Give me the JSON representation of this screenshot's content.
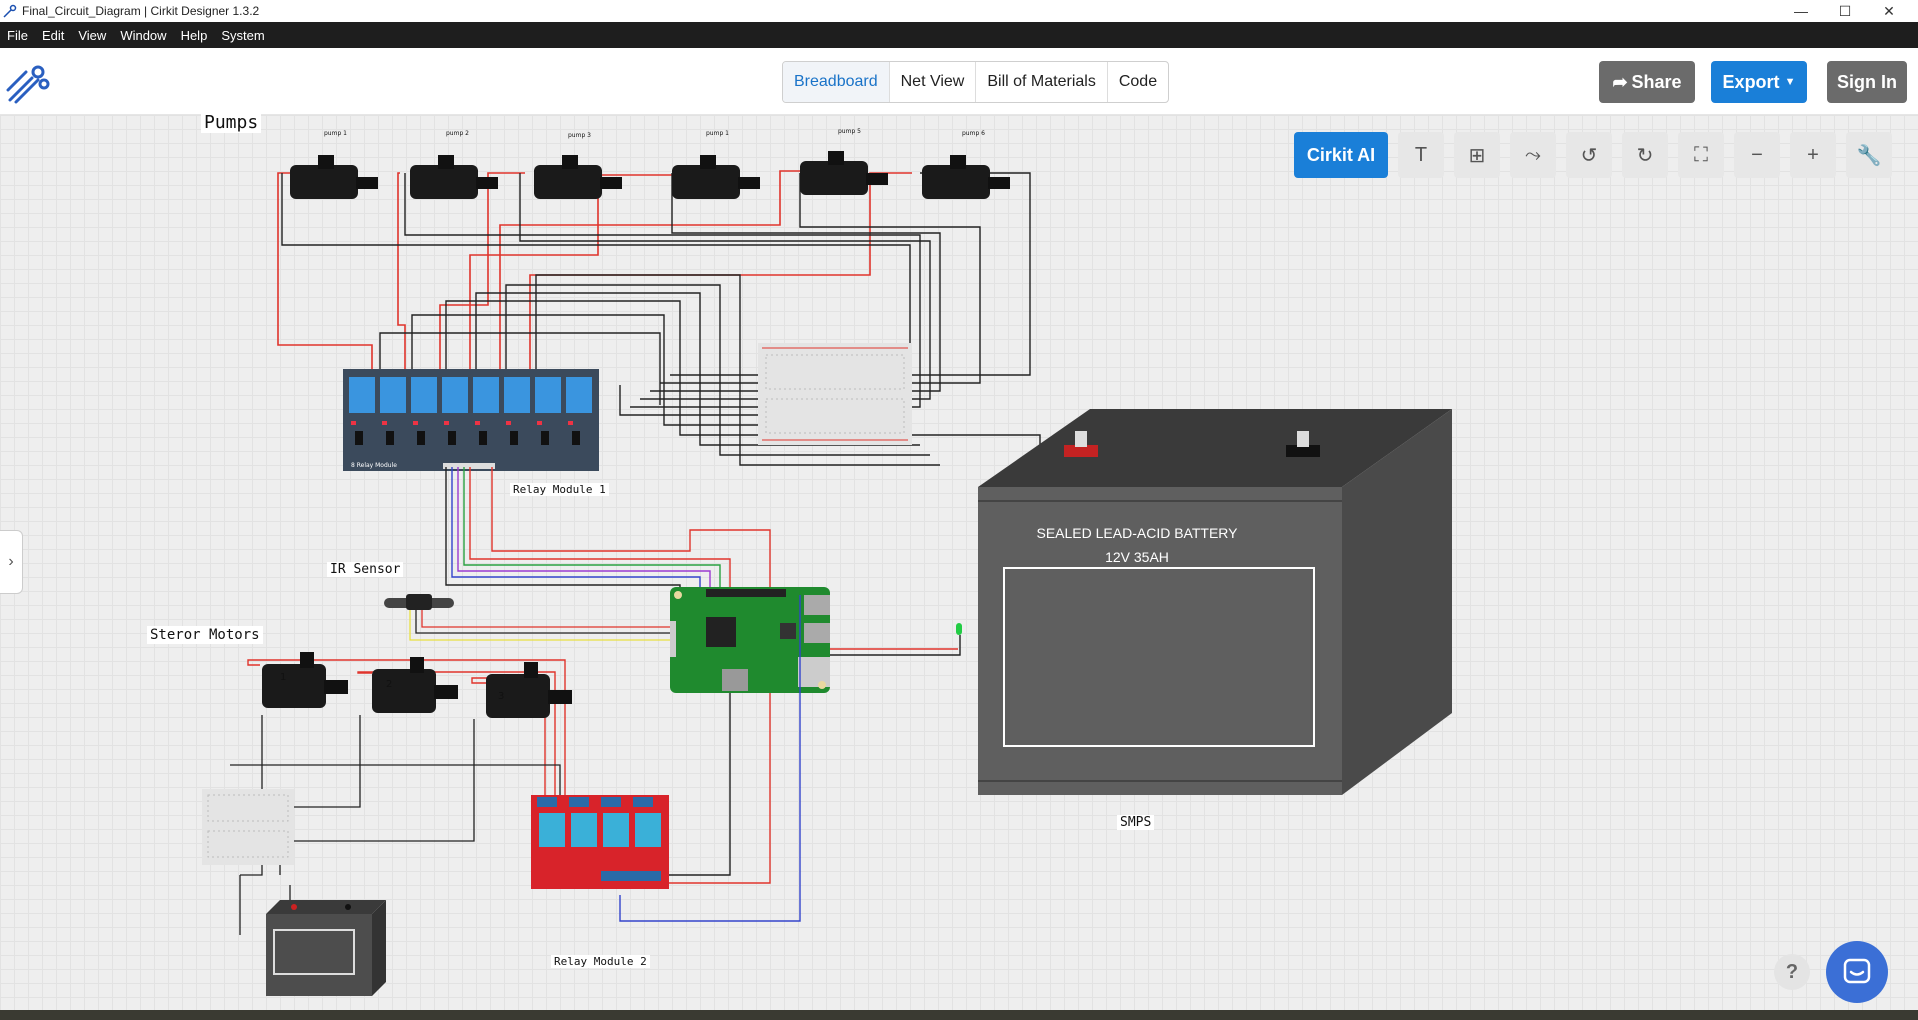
{
  "window": {
    "title": "Final_Circuit_Diagram | Cirkit Designer 1.3.2",
    "controls": [
      "—",
      "☐",
      "✕"
    ]
  },
  "menu": [
    "File",
    "Edit",
    "View",
    "Window",
    "Help",
    "System"
  ],
  "tabs": [
    {
      "label": "Breadboard",
      "active": true
    },
    {
      "label": "Net View",
      "active": false
    },
    {
      "label": "Bill of Materials",
      "active": false
    },
    {
      "label": "Code",
      "active": false
    }
  ],
  "actions": {
    "share": "Share",
    "export": "Export",
    "signin": "Sign In"
  },
  "toolbar": {
    "cirkit_ai": "Cirkit AI",
    "tools": [
      "text-tool",
      "grid-tool",
      "wire-tool",
      "undo",
      "redo",
      "fullscreen",
      "zoom-out",
      "zoom-in",
      "settings"
    ]
  },
  "canvas_labels": {
    "pumps": "Pumps",
    "relay1": "Relay Module 1",
    "ir_sensor": "IR Sensor",
    "steror_motors": "Steror Motors",
    "smps": "SMPS",
    "relay2": "Relay Module 2",
    "relay1_board": "8 Relay Module",
    "motor1": "1",
    "motor2": "2",
    "motor3": "3"
  },
  "pump_tags": [
    "pump 1",
    "pump 2",
    "pump 3",
    "pump 1",
    "pump 5",
    "pump 6"
  ],
  "battery": {
    "line1": "SEALED LEAD-ACID BATTERY",
    "line2": "12V 35AH"
  },
  "help": "?",
  "colors": {
    "accent": "#1a7fd8",
    "share_bg": "#6b6b6b",
    "wire_red": "#e0342c",
    "wire_black": "#222222",
    "relay1_blue": "#3a95df",
    "relay2_red": "#d8232a",
    "pi_green": "#1f8a2e"
  }
}
